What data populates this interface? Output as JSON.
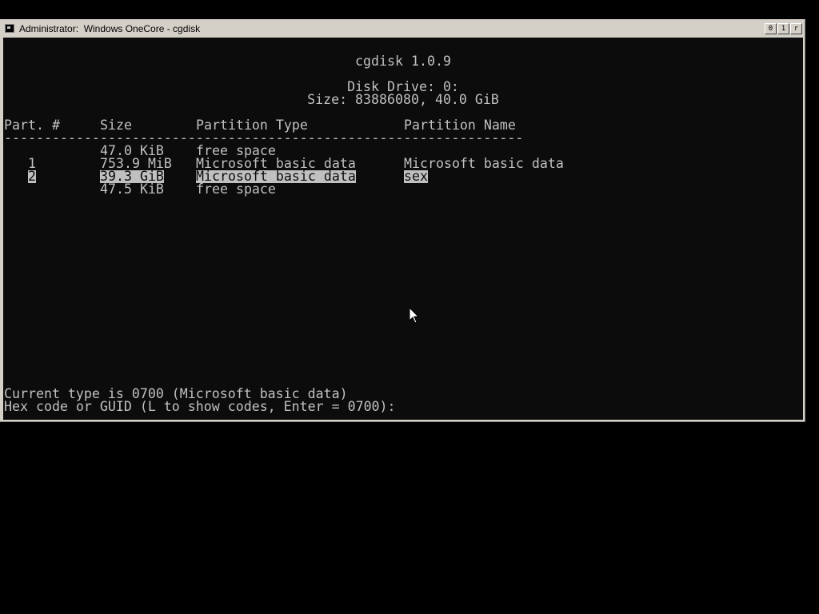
{
  "window": {
    "title": "Administrator:  Windows OneCore - cgdisk",
    "buttons": [
      "0",
      "1",
      "r"
    ]
  },
  "header": {
    "app_version": "cgdisk 1.0.9",
    "disk_drive": "Disk Drive: 0:",
    "size": "Size: 83886080, 40.0 GiB"
  },
  "table": {
    "columns": [
      "Part. #",
      "Size",
      "Partition Type",
      "Partition Name"
    ],
    "separator": "-----------------------------------------------------------------",
    "rows": [
      {
        "num": "",
        "size": "47.0 KiB",
        "type": "free space",
        "name": ""
      },
      {
        "num": "1",
        "size": "753.9 MiB",
        "type": "Microsoft basic data",
        "name": "Microsoft basic data"
      },
      {
        "num": "2",
        "size": "39.3 GiB",
        "type": "Microsoft basic data",
        "name": "sex"
      },
      {
        "num": "",
        "size": "47.5 KiB",
        "type": "free space",
        "name": ""
      }
    ]
  },
  "prompt": {
    "current_type": "Current type is 0700 (Microsoft basic data)",
    "input_prompt": "Hex code or GUID (L to show codes, Enter = 0700):"
  }
}
